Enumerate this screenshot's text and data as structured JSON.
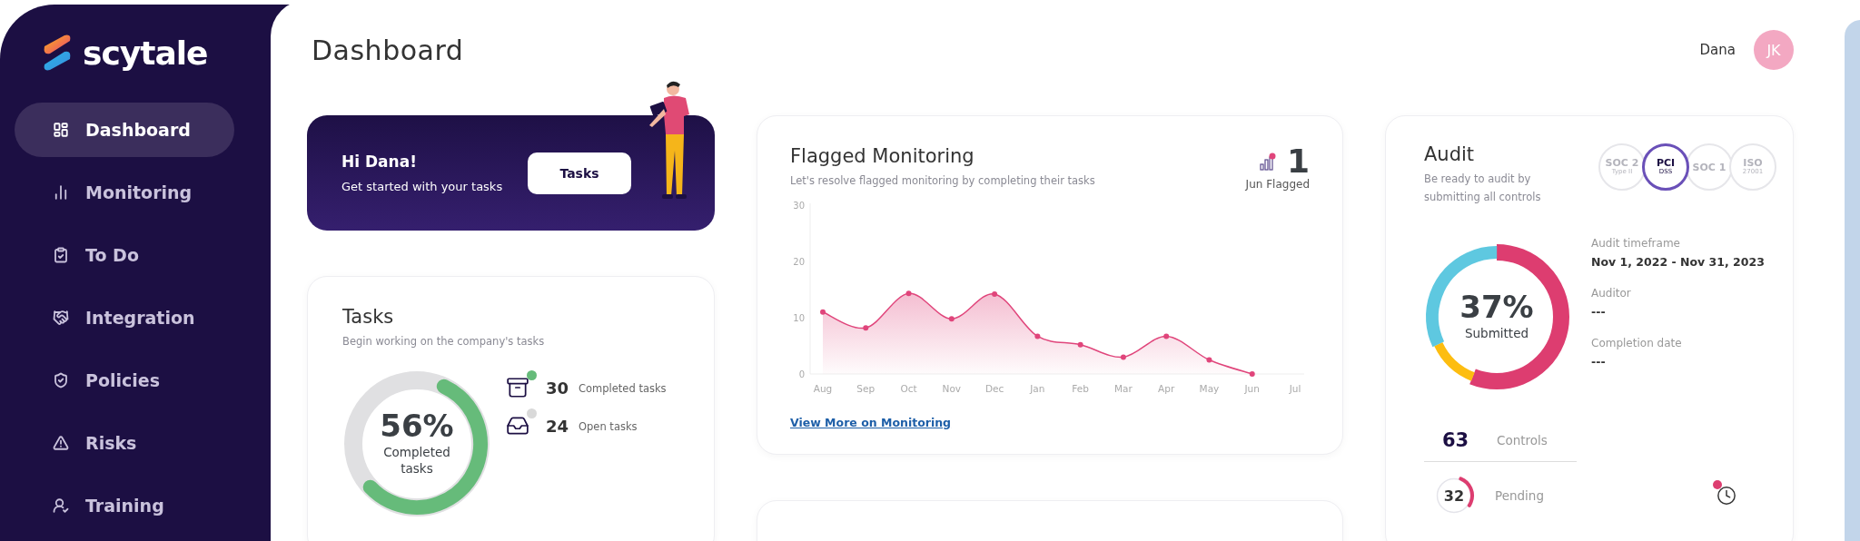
{
  "sidebar": {
    "logo": "scytale",
    "items": [
      {
        "label": "Dashboard",
        "selected": true
      },
      {
        "label": "Monitoring",
        "selected": false
      },
      {
        "label": "To Do",
        "selected": false
      },
      {
        "label": "Integration",
        "selected": false
      },
      {
        "label": "Policies",
        "selected": false
      },
      {
        "label": "Risks",
        "selected": false
      },
      {
        "label": "Training",
        "selected": false
      }
    ]
  },
  "header": {
    "title": "Dashboard",
    "user_name": "Dana",
    "avatar_initials": "JK"
  },
  "welcome": {
    "title": "Hi Dana!",
    "subtitle": "Get started with your tasks",
    "button": "Tasks"
  },
  "tasks_card": {
    "title": "Tasks",
    "subtitle": "Begin working on the company's tasks",
    "donut": {
      "level": 0.56,
      "percent": "56%",
      "label": "Completed tasks"
    },
    "stats": [
      {
        "kind": "completed",
        "value": "30",
        "label": "Completed tasks",
        "color": "#66bb7a"
      },
      {
        "kind": "open",
        "value": "24",
        "label": "Open tasks",
        "color": "#d9d9d9"
      }
    ]
  },
  "flagged_card": {
    "title": "Flagged Monitoring",
    "subtitle": "Let's resolve flagged monitoring by completing their tasks",
    "flag_count": "1",
    "flag_label": "Jun Flagged",
    "link": "View More on Monitoring",
    "chart_data": {
      "type": "area",
      "categories": [
        "Aug",
        "Sep",
        "Oct",
        "Nov",
        "Dec",
        "Jan",
        "Feb",
        "Mar",
        "Apr",
        "May",
        "Jun",
        "Jul"
      ],
      "series": [
        {
          "color": "#e0457b",
          "values": [
            11,
            8.2,
            14.3,
            9.8,
            14.2,
            6.7,
            5.2,
            3,
            6.7,
            2.5,
            0,
            null
          ]
        }
      ],
      "ylim": [
        0,
        30
      ],
      "yticks": [
        0,
        10,
        20,
        30
      ]
    }
  },
  "audit_card": {
    "title": "Audit",
    "subtitle": "Be ready to audit by submitting all controls",
    "badges": [
      {
        "title": "SOC 2",
        "caption": "Type II",
        "selected": false
      },
      {
        "title": "PCI",
        "caption": "DSS",
        "selected": true
      },
      {
        "title": "SOC 1",
        "selected": false
      },
      {
        "title": "ISO",
        "caption": "27001",
        "selected": false
      }
    ],
    "donut": {
      "percent": "37%",
      "label": "Submitted",
      "segments": [
        {
          "color": "#dd3d70",
          "level": 0.56
        },
        {
          "color": "#fdbd10",
          "level": 0.12
        },
        {
          "color": "#5ec8e0",
          "level": 0.32
        }
      ]
    },
    "details": [
      {
        "label": "Audit timeframe",
        "value": "Nov 1, 2022 - Nov 31, 2023"
      },
      {
        "label": "Auditor",
        "value": "---"
      },
      {
        "label": "Completion date",
        "value": "---"
      }
    ],
    "controls": {
      "value": "63",
      "label": "Controls"
    },
    "pending": {
      "value": "32",
      "label": "Pending",
      "level": 0.28
    }
  }
}
